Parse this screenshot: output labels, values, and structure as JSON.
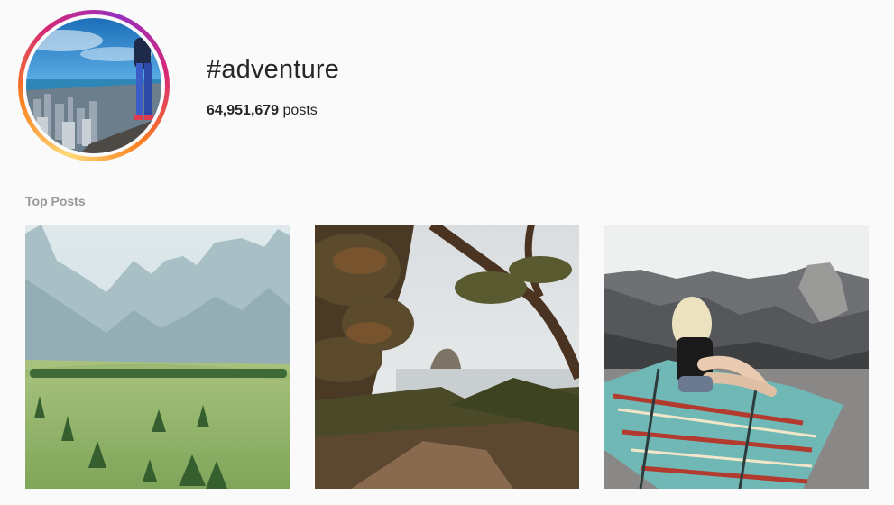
{
  "hashtag": {
    "title": "#adventure",
    "post_count": "64,951,679",
    "post_count_suffix": "posts"
  },
  "sections": {
    "top_posts_label": "Top Posts"
  },
  "posts": [
    {
      "subject": "mountain meadow with pine trees"
    },
    {
      "subject": "coastal trees framing sea stack"
    },
    {
      "subject": "woman on patterned blanket overlooking valley"
    }
  ],
  "colors": {
    "ring_gradient": [
      "#feda75",
      "#fa7e1e",
      "#d62976",
      "#962fbf"
    ],
    "label_gray": "#999999",
    "text": "#262626",
    "background": "#fafafa"
  }
}
